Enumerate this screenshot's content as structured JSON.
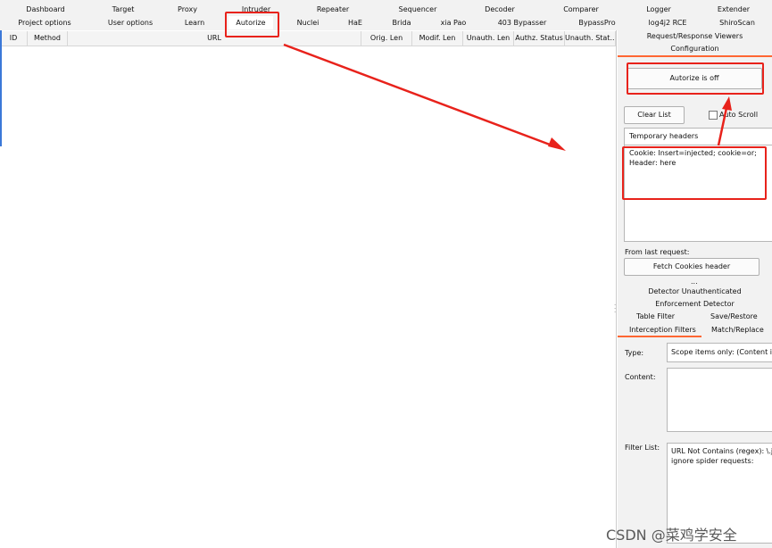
{
  "tabs_row1": [
    "Dashboard",
    "Target",
    "Proxy",
    "Intruder",
    "Repeater",
    "Sequencer",
    "Decoder",
    "Comparer",
    "Logger",
    "Extender"
  ],
  "tabs_row2": [
    "Project options",
    "User options",
    "Learn",
    "Autorize",
    "Nuclei",
    "HaE",
    "Brida",
    "xia Pao",
    "403 Bypasser",
    "BypassPro",
    "log4j2 RCE",
    "ShiroScan"
  ],
  "active_tab": "Autorize",
  "table": {
    "columns": [
      "ID",
      "Method",
      "URL",
      "Orig. Len",
      "Modif. Len",
      "Unauth. Len",
      "Authz. Status",
      "Unauth. Stat..."
    ]
  },
  "right_panel": {
    "tab_req_resp": "Request/Response Viewers",
    "tab_configuration": "Configuration",
    "autorize_toggle_label": "Autorize is off",
    "clear_list_label": "Clear List",
    "auto_scroll_label": "Auto Scroll",
    "temp_headers_label": "Temporary headers",
    "headers_line1": "Cookie: Insert=injected; cookie=or;",
    "headers_line2": "Header: here",
    "from_last_request_label": "From last request:",
    "fetch_cookies_label": "Fetch Cookies header",
    "ellipsis": "...",
    "detector_unauth_label": "Detector Unauthenticated",
    "enforcement_detector_label": "Enforcement Detector",
    "table_filter_label": "Table Filter",
    "save_restore_label": "Save/Restore",
    "interception_filters_label": "Interception Filters",
    "match_replace_label": "Match/Replace",
    "type_label": "Type:",
    "type_value": "Scope items only: (Content is n",
    "content_label": "Content:",
    "filter_list_label": "Filter List:",
    "filter_line1": "URL Not Contains (regex): \\.js|\\",
    "filter_line2": "ignore spider requests:"
  },
  "watermark": "CSDN @菜鸡学安全",
  "colors": {
    "highlight_red": "#e8221b",
    "active_underline": "#ff6633"
  }
}
